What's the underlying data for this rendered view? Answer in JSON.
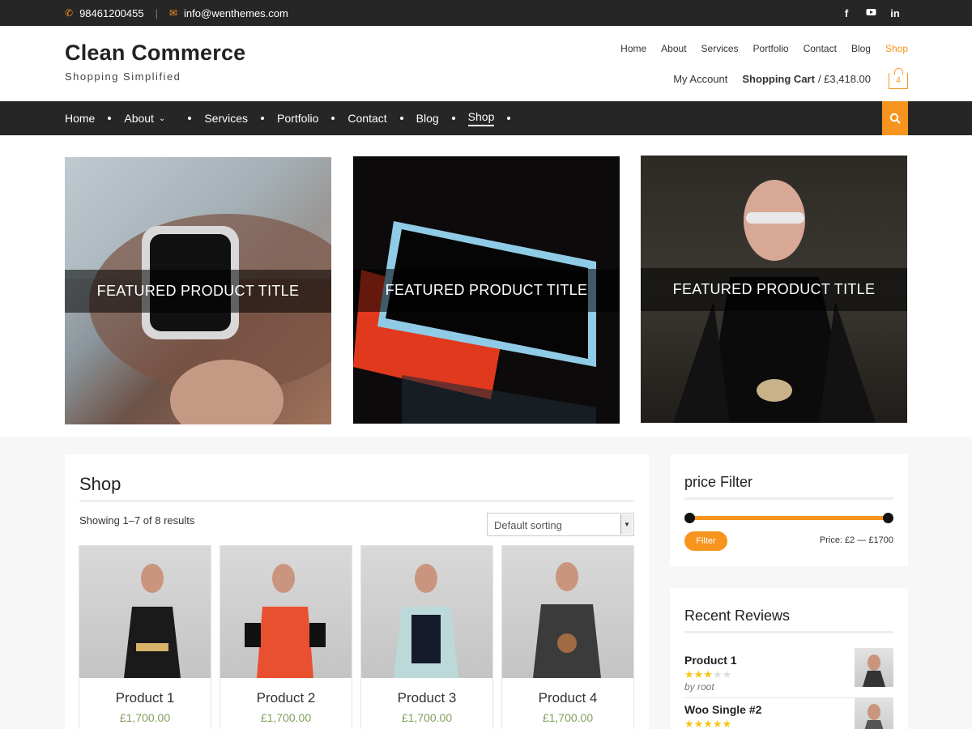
{
  "topbar": {
    "phone": "98461200455",
    "email": "info@wenthemes.com",
    "social": [
      "facebook-icon",
      "youtube-icon",
      "linkedin-icon"
    ]
  },
  "header": {
    "site_title": "Clean Commerce",
    "tagline": "Shopping Simplified",
    "top_menu": [
      "Home",
      "About",
      "Services",
      "Portfolio",
      "Contact",
      "Blog",
      "Shop"
    ],
    "top_menu_active": "Shop",
    "my_account": "My Account",
    "cart_label": "Shopping Cart",
    "cart_amount": "/ £3,418.00",
    "cart_count": "4"
  },
  "main_nav": {
    "items": [
      "Home",
      "About",
      "Services",
      "Portfolio",
      "Contact",
      "Blog",
      "Shop"
    ],
    "active": "Shop"
  },
  "featured": [
    {
      "title": "FEATURED PRODUCT TITLE"
    },
    {
      "title": "FEATURED PRODUCT TITLE"
    },
    {
      "title": "FEATURED PRODUCT TITLE"
    }
  ],
  "shop": {
    "title": "Shop",
    "result_count": "Showing 1–7 of 8 results",
    "sort_value": "Default sorting",
    "products": [
      {
        "name": "Product 1",
        "price": "£1,700.00"
      },
      {
        "name": "Product 2",
        "price": "£1,700.00"
      },
      {
        "name": "Product 3",
        "price": "£1,700.00"
      },
      {
        "name": "Product 4",
        "price": "£1,700.00"
      }
    ]
  },
  "price_filter": {
    "title": "price Filter",
    "button": "Filter",
    "range": "Price: £2 — £1700"
  },
  "recent_reviews": {
    "title": "Recent Reviews",
    "items": [
      {
        "name": "Product 1",
        "rating": 3,
        "by": "by root"
      },
      {
        "name": "Woo Single #2",
        "rating": 5,
        "by": ""
      }
    ]
  },
  "colors": {
    "accent": "#f7941d",
    "dark_bar": "#262626",
    "price_green": "#81a05b"
  }
}
